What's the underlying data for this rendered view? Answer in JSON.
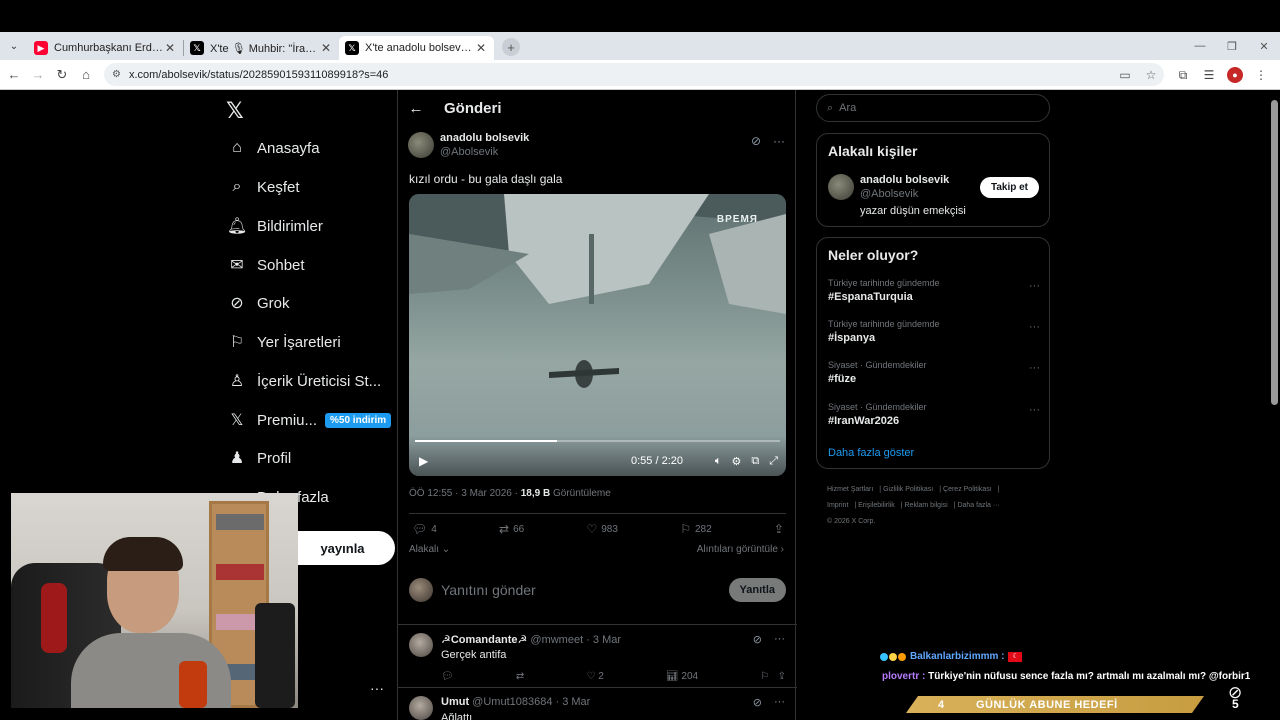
{
  "browser": {
    "tabs": [
      {
        "title": "Cumhurbaşkanı Erdoğan: İran'ı...",
        "favicon": "youtube-icon"
      },
      {
        "title": "X'te 🎙 Muhbir: \"İran Türkleri,...",
        "favicon": "x-icon"
      },
      {
        "title": "X'te anadolu bolsevik: \"kızıl ord...",
        "favicon": "x-icon"
      }
    ],
    "url": "x.com/abolsevik/status/2028590159311089918?s=46"
  },
  "nav": {
    "items": [
      "Anasayfa",
      "Keşfet",
      "Bildirimler",
      "Sohbet",
      "Grok",
      "Yer İşaretleri",
      "İçerik Üreticisi St...",
      "Premiu...",
      "Profil",
      "Daha fazla"
    ],
    "promo_badge": "%50 indirim",
    "post_button": "yayınla"
  },
  "header": {
    "title": "Gönderi"
  },
  "post": {
    "author_name": "anadolu bolsevik",
    "author_handle": "@Abolsevik",
    "text": "kızıl ordu - bu gala daşlı gala",
    "video_logo": "ВРЕМЯ",
    "video_time": "0:55 / 2:20",
    "video_progress": 0.39,
    "meta_time": "ÖÖ 12:55 · 3 Mar 2026 ·",
    "meta_views": "18,9 B",
    "meta_views_label": "Görüntüleme",
    "stats": {
      "replies": "4",
      "reposts": "66",
      "likes": "983",
      "bookmarks": "282"
    },
    "related_label": "Alakalı",
    "quotes_label": "Alıntıları görüntüle",
    "reply_placeholder": "Yanıtını gönder",
    "reply_button": "Yanıtla"
  },
  "replies": [
    {
      "name": "☭Comandante☭",
      "handle": "@mwmeet · 3 Mar",
      "text": "Gerçek antifa",
      "likes": "2",
      "views": "204"
    },
    {
      "name": "Umut",
      "handle": "@Umut1083684 · 3 Mar",
      "text": "Ağlattı"
    }
  ],
  "sidebar": {
    "search_placeholder": "Ara",
    "related_title": "Alakalı kişiler",
    "related_user": {
      "name": "anadolu bolsevik",
      "handle": "@Abolsevik",
      "bio": "yazar düşün emekçisi",
      "follow_label": "Takip et"
    },
    "trending_title": "Neler oluyor?",
    "trends": [
      {
        "context": "Türkiye tarihinde gündemde",
        "name": "#EspanaTurquia"
      },
      {
        "context": "Türkiye tarihinde gündemde",
        "name": "#İspanya"
      },
      {
        "context": "Siyaset · Gündemdekiler",
        "name": "#füze"
      },
      {
        "context": "Siyaset · Gündemdekiler",
        "name": "#IranWar2026"
      }
    ],
    "show_more": "Daha fazla göster",
    "footer": [
      "Hizmet Şartları",
      "Gizlilik Politikası",
      "Çerez Politikası",
      "Imprint",
      "Erişilebilirlik",
      "Reklam bilgisi",
      "Daha fazla ···",
      "© 2026 X Corp."
    ]
  },
  "stream": {
    "chat1_user": "Balkanlarbizimmm :",
    "chat2_user": "plovertr :",
    "chat2_text": "Türkiye'nin nüfusu sence fazla mı? artmalı mı azalmalı mı? @forbir1",
    "goal_current": "4",
    "goal_label": "GÜNLÜK ABUNE HEDEFİ",
    "goal_target": "5"
  }
}
